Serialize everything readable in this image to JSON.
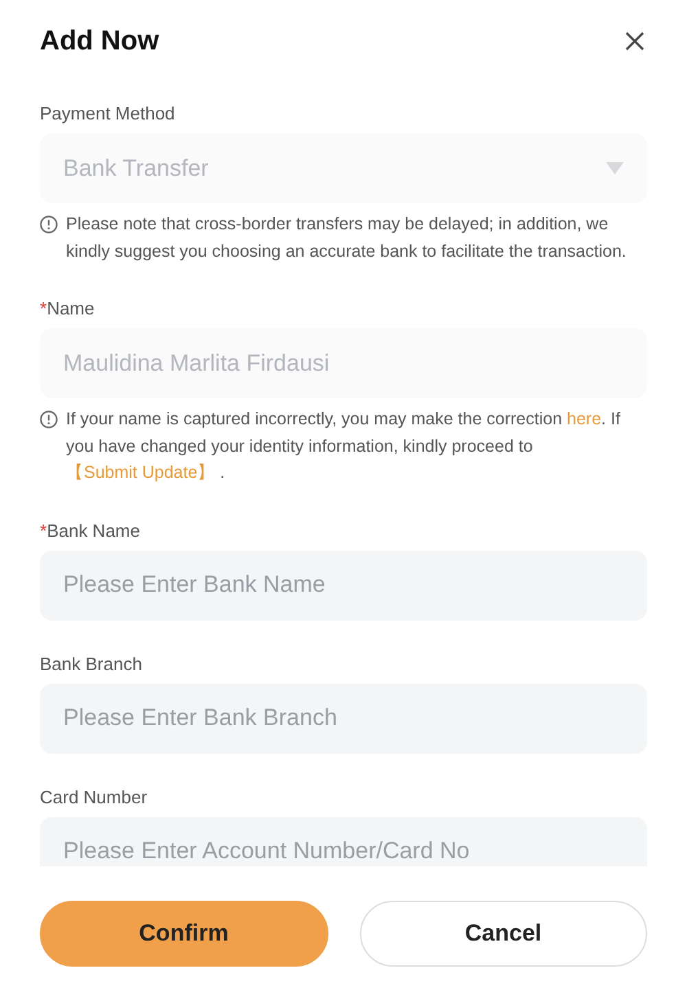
{
  "dialog": {
    "title": "Add Now"
  },
  "required_marker": "*",
  "fields": [
    {
      "label": "Payment Method",
      "required": false,
      "kind": "select",
      "disabled": true,
      "value": "Bank Transfer",
      "note": [
        {
          "kind": "text",
          "text": "Please note that cross-border transfers may be delayed; in addition, we kindly suggest you choosing an accurate bank to facilitate the transaction."
        }
      ]
    },
    {
      "label": "Name",
      "required": true,
      "kind": "text",
      "disabled": true,
      "value": "Maulidina Marlita Firdausi",
      "note": [
        {
          "kind": "text",
          "text": "If your name is captured incorrectly, you may make the correction "
        },
        {
          "kind": "link",
          "text": "here"
        },
        {
          "kind": "text",
          "text": ". If you have changed your identity information, kindly proceed to "
        },
        {
          "kind": "link",
          "text": "【Submit Update】"
        },
        {
          "kind": "text",
          "text": " ."
        }
      ]
    },
    {
      "label": "Bank Name",
      "required": true,
      "kind": "text",
      "disabled": false,
      "placeholder": "Please Enter Bank Name"
    },
    {
      "label": "Bank Branch",
      "required": false,
      "kind": "text",
      "disabled": false,
      "placeholder": "Please Enter Bank Branch"
    },
    {
      "label": "Card Number",
      "required": false,
      "kind": "text",
      "disabled": false,
      "placeholder": "Please Enter Account Number/Card No"
    }
  ],
  "buttons": [
    {
      "label": "Confirm",
      "kind": "primary"
    },
    {
      "label": "Cancel",
      "kind": "secondary"
    }
  ]
}
